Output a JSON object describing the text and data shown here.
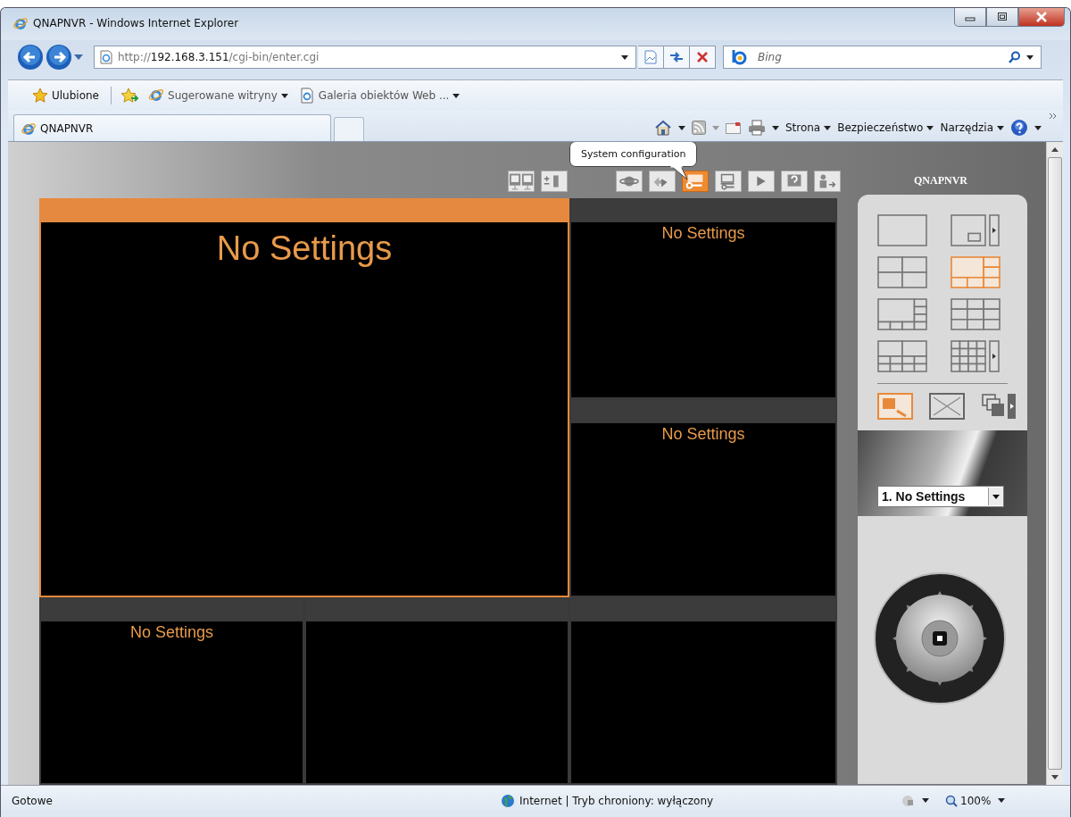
{
  "window": {
    "title": "QNAPNVR - Windows Internet Explorer"
  },
  "nav": {
    "url_host": "http://",
    "url_domain": "192.168.3.151",
    "url_path": "/cgi-bin/enter.cgi",
    "search_placeholder": "Bing"
  },
  "favorites": [
    {
      "label": "Ulubione",
      "kind": "star"
    },
    {
      "label": "Sugerowane witryny",
      "kind": "suggested"
    },
    {
      "label": "Galeria obiektów Web ...",
      "kind": "gallery"
    }
  ],
  "tabs": [
    {
      "label": "QNAPNVR",
      "selected": true
    }
  ],
  "command_bar": [
    "Strona",
    "Bezpieczeństwo",
    "Narzędzia"
  ],
  "app": {
    "brand": "QNAPNVR",
    "tooltip": "System configuration",
    "toolbar": [
      {
        "kind": "monitors",
        "selected": false
      },
      {
        "kind": "plusminus",
        "selected": false
      },
      {
        "kind": "globe",
        "selected": false
      },
      {
        "kind": "arrows",
        "selected": false
      },
      {
        "kind": "config",
        "selected": true
      },
      {
        "kind": "maintenance",
        "selected": false
      },
      {
        "kind": "play",
        "selected": false
      },
      {
        "kind": "help",
        "selected": false
      },
      {
        "kind": "logout",
        "selected": false
      }
    ],
    "views": [
      {
        "title": "No Settings",
        "selected": true
      },
      {
        "title": "No Settings",
        "selected": false
      },
      {
        "title": "No Settings",
        "selected": false
      },
      {
        "title": "No Settings",
        "selected": false
      },
      {
        "selected": false
      },
      {
        "selected": false
      }
    ],
    "layouts": [
      {
        "kind": "single",
        "selected": false
      },
      {
        "kind": "pip",
        "selected": false
      },
      {
        "kind": "quad",
        "selected": false
      },
      {
        "kind": "six",
        "selected": true
      },
      {
        "kind": "eight",
        "selected": false
      },
      {
        "kind": "nine",
        "selected": false
      },
      {
        "kind": "ten",
        "selected": false
      },
      {
        "kind": "sixteen",
        "selected": false
      }
    ],
    "modes": [
      {
        "kind": "focus",
        "selected": true
      },
      {
        "kind": "fullscreen",
        "selected": false
      },
      {
        "kind": "sequence",
        "selected": false
      }
    ],
    "camera_select": "1. No Settings"
  },
  "status_bar": {
    "text": "Gotowe",
    "zone": "Internet | Tryb chroniony: wyłączony",
    "zoom": "100%"
  }
}
